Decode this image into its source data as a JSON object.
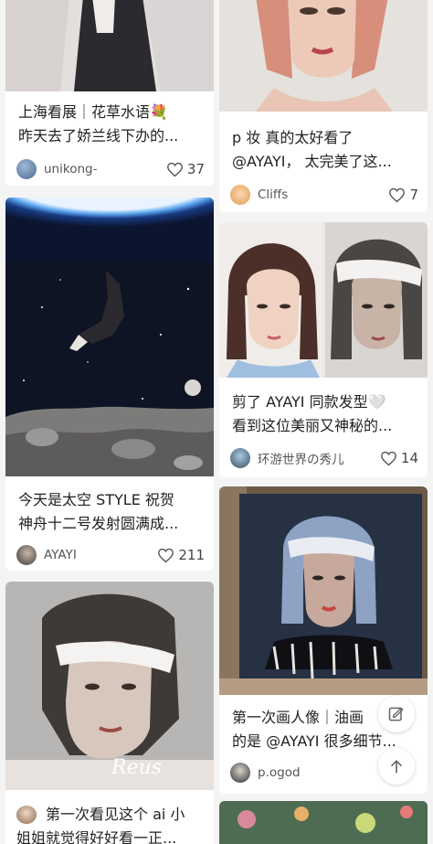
{
  "feed": {
    "left": [
      {
        "title_line1": "上海看展｜花草水语💐",
        "title_line2": "昨天去了娇兰线下办的...",
        "author": "unikong-",
        "likes": "37"
      },
      {
        "title_line1": "今天是太空 STYLE 祝贺",
        "title_line2": "神舟十二号发射圆满成...",
        "author": "AYAYI",
        "likes": "211"
      },
      {
        "title_line1": "第一次看见这个 ai 小",
        "title_line2": "姐姐就觉得好好看一正..."
      }
    ],
    "right": [
      {
        "title_line1": "p 妆 真的太好看了",
        "title_line2": "@AYAYI， 太完美了这...",
        "author": "Cliffs",
        "likes": "7"
      },
      {
        "title_line1": "剪了 AYAYI 同款发型🤍",
        "title_line2": "看到这位美丽又神秘的...",
        "author": "环游世界の秀儿",
        "likes": "14"
      },
      {
        "title_line1": "第一次画人像｜油画",
        "title_line2": "的是 @AYAYI 很多细节...",
        "author": "p.ogod"
      }
    ]
  },
  "signature_text": "Reus",
  "icons": {
    "like": "heart-outline-icon",
    "edit": "edit-note-icon",
    "top": "arrow-up-icon"
  }
}
